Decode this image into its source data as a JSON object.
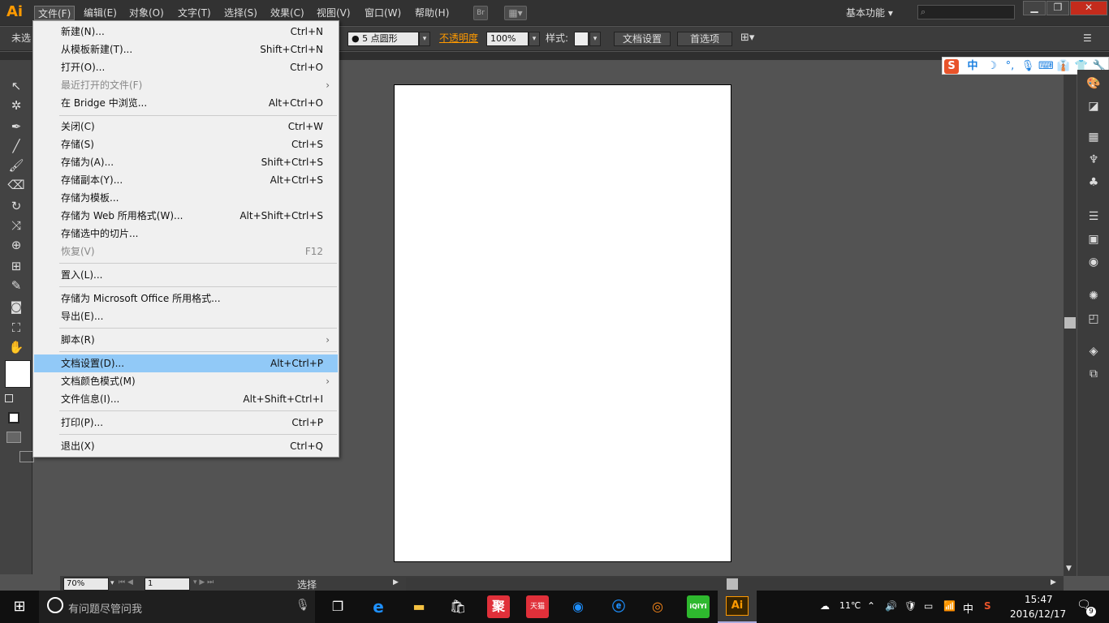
{
  "app": {
    "logo": "Ai"
  },
  "menubar": {
    "items": [
      "文件(F)",
      "编辑(E)",
      "对象(O)",
      "文字(T)",
      "选择(S)",
      "效果(C)",
      "视图(V)",
      "窗口(W)",
      "帮助(H)"
    ],
    "bridge_button": "Br",
    "workspace": "基本功能"
  },
  "controlbar": {
    "selection_label": "未选",
    "brush_value": "5 点圆形",
    "opacity_label": "不透明度",
    "opacity_value": "100%",
    "style_label": "样式:",
    "doc_setup_button": "文档设置",
    "preferences_button": "首选项"
  },
  "file_menu": {
    "items": [
      {
        "label": "新建(N)...",
        "shortcut": "Ctrl+N"
      },
      {
        "label": "从模板新建(T)...",
        "shortcut": "Shift+Ctrl+N"
      },
      {
        "label": "打开(O)...",
        "shortcut": "Ctrl+O"
      },
      {
        "label": "最近打开的文件(F)",
        "shortcut": ""
      },
      {
        "label": "在 Bridge 中浏览...",
        "shortcut": "Alt+Ctrl+O"
      },
      {
        "label": "关闭(C)",
        "shortcut": "Ctrl+W"
      },
      {
        "label": "存储(S)",
        "shortcut": "Ctrl+S"
      },
      {
        "label": "存储为(A)...",
        "shortcut": "Shift+Ctrl+S"
      },
      {
        "label": "存储副本(Y)...",
        "shortcut": "Alt+Ctrl+S"
      },
      {
        "label": "存储为模板...",
        "shortcut": ""
      },
      {
        "label": "存储为 Web 所用格式(W)...",
        "shortcut": "Alt+Shift+Ctrl+S"
      },
      {
        "label": "存储选中的切片...",
        "shortcut": ""
      },
      {
        "label": "恢复(V)",
        "shortcut": "F12"
      },
      {
        "label": "置入(L)...",
        "shortcut": ""
      },
      {
        "label": "存储为 Microsoft Office 所用格式...",
        "shortcut": ""
      },
      {
        "label": "导出(E)...",
        "shortcut": ""
      },
      {
        "label": "脚本(R)",
        "shortcut": ""
      },
      {
        "label": "文档设置(D)...",
        "shortcut": "Alt+Ctrl+P"
      },
      {
        "label": "文档颜色模式(M)",
        "shortcut": ""
      },
      {
        "label": "文件信息(I)...",
        "shortcut": "Alt+Shift+Ctrl+I"
      },
      {
        "label": "打印(P)...",
        "shortcut": "Ctrl+P"
      },
      {
        "label": "退出(X)",
        "shortcut": "Ctrl+Q"
      }
    ]
  },
  "ime_bar": {
    "mode": "中"
  },
  "statusbar": {
    "zoom": "70%",
    "page": "1",
    "status": "选择"
  },
  "taskbar": {
    "search_placeholder": "有问题尽管问我",
    "weather": "11℃",
    "ime": "中",
    "time": "15:47",
    "date": "2016/12/17",
    "notifications": "9",
    "app_labels": {
      "ju": "聚",
      "tmall": "天猫",
      "iqiyi": "iQIYI",
      "ai": "Ai"
    }
  }
}
